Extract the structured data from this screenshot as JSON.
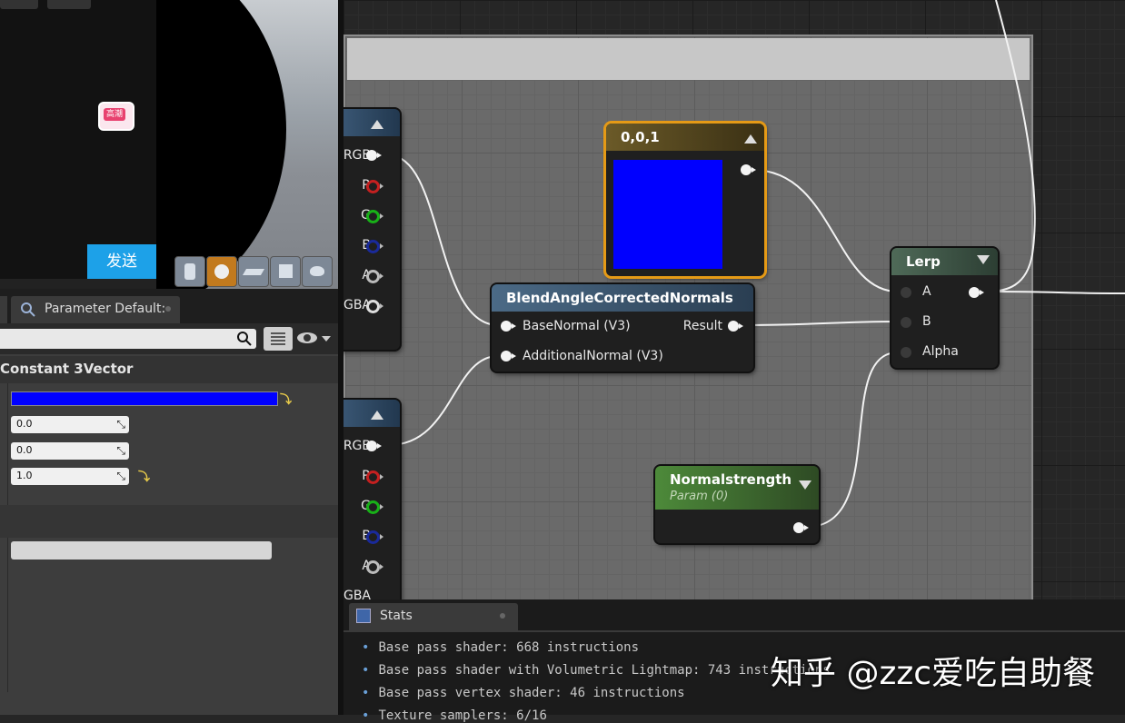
{
  "preview": {
    "send_label": "发送",
    "badge": "高潮",
    "toolbar_icons": [
      "cylinder-icon",
      "sphere-icon",
      "plane-icon",
      "cube-icon",
      "teapot-icon"
    ]
  },
  "details": {
    "tab_label": "Parameter Default:",
    "section_title": "Constant 3Vector",
    "constant_color": "#0000ff",
    "values": [
      "0.0",
      "0.0",
      "1.0"
    ]
  },
  "nodes": {
    "texture1": {
      "pins": [
        "RGB",
        "R",
        "G",
        "B",
        "A",
        "GBA"
      ]
    },
    "texture2": {
      "pins": [
        "RGB",
        "R",
        "G",
        "B",
        "A",
        "GBA"
      ]
    },
    "constant": {
      "title": "0,0,1",
      "color": "#0000ff"
    },
    "blend": {
      "title": "BlendAngleCorrectedNormals",
      "input1": "BaseNormal (V3)",
      "input2": "AdditionalNormal (V3)",
      "output": "Result"
    },
    "lerp": {
      "title": "Lerp",
      "a": "A",
      "b": "B",
      "alpha": "Alpha"
    },
    "param": {
      "title": "Normalstrength",
      "subtitle": "Param (0)"
    }
  },
  "stats": {
    "tab_label": "Stats",
    "lines": [
      "Base pass shader: 668 instructions",
      "Base pass shader with Volumetric Lightmap: 743 instructions",
      "Base pass vertex shader: 46 instructions",
      "Texture samplers: 6/16"
    ]
  },
  "watermark": "知乎 @zzc爱吃自助餐"
}
